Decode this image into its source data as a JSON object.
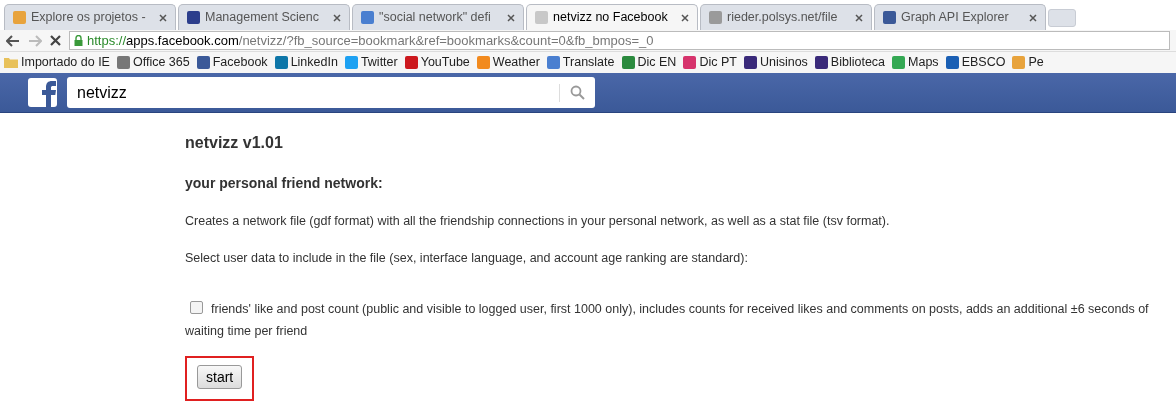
{
  "tabs": [
    {
      "title": "Explore os projetos -",
      "selected": false,
      "color": "#e8a33c"
    },
    {
      "title": "Management Scienc",
      "selected": false,
      "color": "#2c3e8c"
    },
    {
      "title": "\"social network\" defi",
      "selected": false,
      "color": "#4a7fd0"
    },
    {
      "title": "netvizz no Facebook",
      "selected": true,
      "color": "#c8c8c8"
    },
    {
      "title": "rieder.polsys.net/file",
      "selected": false,
      "color": "#9a9a9a"
    },
    {
      "title": "Graph API Explorer",
      "selected": false,
      "color": "#3b5998"
    }
  ],
  "address": {
    "scheme": "https://",
    "host": "apps.facebook.com",
    "path": "/netvizz/?fb_source=bookmark&ref=bookmarks&count=0&fb_bmpos=_0"
  },
  "bookmarks": [
    {
      "label": "Importado do IE",
      "kind": "folder",
      "color": "#e8c15a"
    },
    {
      "label": "Office 365",
      "kind": "site",
      "color": "#777777"
    },
    {
      "label": "Facebook",
      "kind": "site",
      "color": "#3b5998"
    },
    {
      "label": "LinkedIn",
      "kind": "site",
      "color": "#0e76a8"
    },
    {
      "label": "Twitter",
      "kind": "site",
      "color": "#1da1f2"
    },
    {
      "label": "YouTube",
      "kind": "site",
      "color": "#cc181e"
    },
    {
      "label": "Weather",
      "kind": "site",
      "color": "#f28a1e"
    },
    {
      "label": "Translate",
      "kind": "site",
      "color": "#4a7fd0"
    },
    {
      "label": "Dic EN",
      "kind": "site",
      "color": "#2b8a3e"
    },
    {
      "label": "Dic PT",
      "kind": "site",
      "color": "#d6336c"
    },
    {
      "label": "Unisinos",
      "kind": "site",
      "color": "#3a2a7a"
    },
    {
      "label": "Biblioteca",
      "kind": "site",
      "color": "#3a2a7a"
    },
    {
      "label": "Maps",
      "kind": "site",
      "color": "#34a853"
    },
    {
      "label": "EBSCO",
      "kind": "site",
      "color": "#1a5fb4"
    },
    {
      "label": "Pe",
      "kind": "site",
      "color": "#e8a33c"
    }
  ],
  "search": {
    "value": "netvizz"
  },
  "app": {
    "title": "netvizz v1.01",
    "subtitle": "your personal friend network:",
    "description": "Creates a network file (gdf format) with all the friendship connections in your personal network, as well as a stat file (tsv format).",
    "instruction": "Select user data to include in the file (sex, interface language, and account age ranking are standard):",
    "option": {
      "label": "friends' like and post count (public and visible to logged user, first 1000 only), includes counts for received likes and comments on posts, adds an additional ±6 seconds of waiting time per friend",
      "checked": false
    },
    "button": "start"
  }
}
